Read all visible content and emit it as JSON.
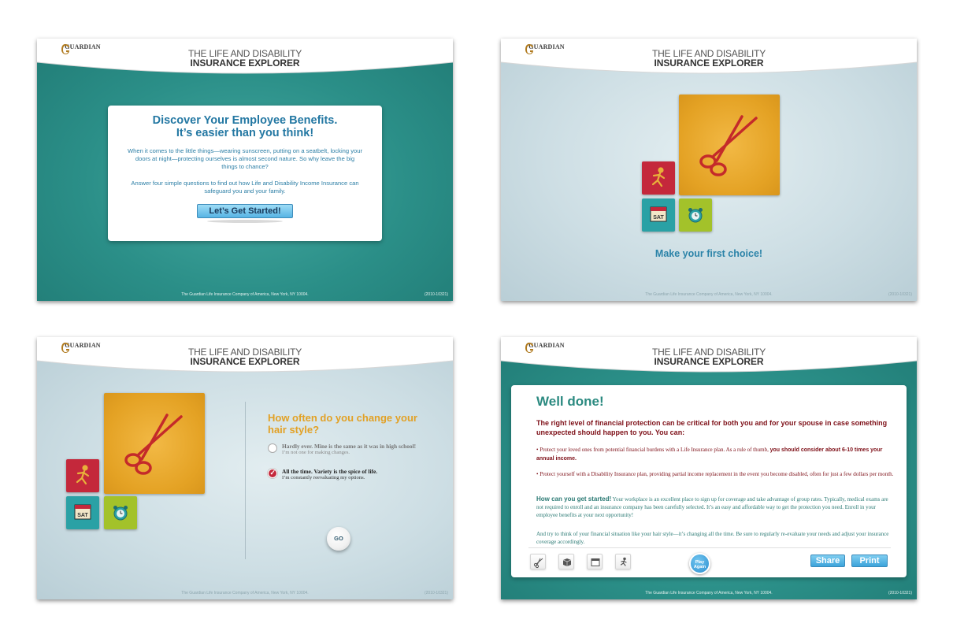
{
  "brand": {
    "logo_text": "GUARDIAN",
    "title_line1": "THE LIFE AND DISABILITY",
    "title_line2": "INSURANCE EXPLORER"
  },
  "footer": {
    "copyright": "The Guardian Life Insurance Company of America, New York, NY 10004.",
    "code": "(2010-10321)"
  },
  "colors": {
    "teal_bg": "#2b8f88",
    "light_bg": "#cddee4",
    "heading_blue": "#2478a3",
    "accent_gold": "#e2a125",
    "accent_red": "#c4283b",
    "deep_red_text": "#7e1018"
  },
  "screen1": {
    "heading_line1": "Discover Your Employee Benefits.",
    "heading_line2": "It’s easier than you think!",
    "para1": "When it comes to the little things—wearing sunscreen, putting on a seatbelt, locking your doors at night—protecting ourselves is almost second nature. So why leave the big things to chance?",
    "para2": "Answer four simple questions to find out how Life and Disability Income Insurance can safeguard you and your family.",
    "cta_label": "Let’s Get Started!"
  },
  "screen2": {
    "tiles": {
      "big": "scissors-icon",
      "red": "running-man-icon",
      "teal": "calendar-sat-icon",
      "green": "alarm-clock-icon"
    },
    "calendar_label": "SAT",
    "prompt": "Make your first choice!"
  },
  "screen3": {
    "calendar_label": "SAT",
    "question": "How often do you change your hair style?",
    "options": [
      {
        "main": "Hardly ever. Mine is the same as it was in high school!",
        "sub": "I’m not one for making changes.",
        "selected": false
      },
      {
        "main": "All the time. Variety is the spice of life.",
        "sub": "I’m constantly reevaluating my options.",
        "selected": true
      }
    ],
    "go_label": "GO"
  },
  "screen4": {
    "title": "Well done!",
    "lead": "The right level of financial protection can be critical for both you and for your spouse in case something unexpected should happen to you. You can:",
    "bullet1_text": "• Protect your loved ones from potential financial burdens with a Life Insurance plan. As a rule of thumb,",
    "bullet1_bold": "you should consider about 6-10 times your annual income.",
    "bullet2_text": "• Protect yourself with a Disability Insurance plan, providing partial income replacement in the event you become disabled, often for just a few dollars per month.",
    "para_bold": "How can you get started!",
    "para_text": "Your workplace is an excellent place to sign up for coverage and take advantage of group rates. Typically, medical exams are not required to enroll and an insurance company has been carefully selected. It’s an easy and affordable way to get the protection you need. Enroll in your employee benefits at your next opportunity!",
    "closing": "And try to think of your financial situation like your hair style—it’s changing all the time. Be sure to regularly re-evaluate your needs and adjust your insurance coverage accordingly.",
    "toolbar_icons": [
      "scissors-icon",
      "package-icon",
      "calendar-icon",
      "running-man-icon"
    ],
    "play_again_line1": "Play",
    "play_again_line2": "Again",
    "share_label": "Share",
    "print_label": "Print"
  }
}
